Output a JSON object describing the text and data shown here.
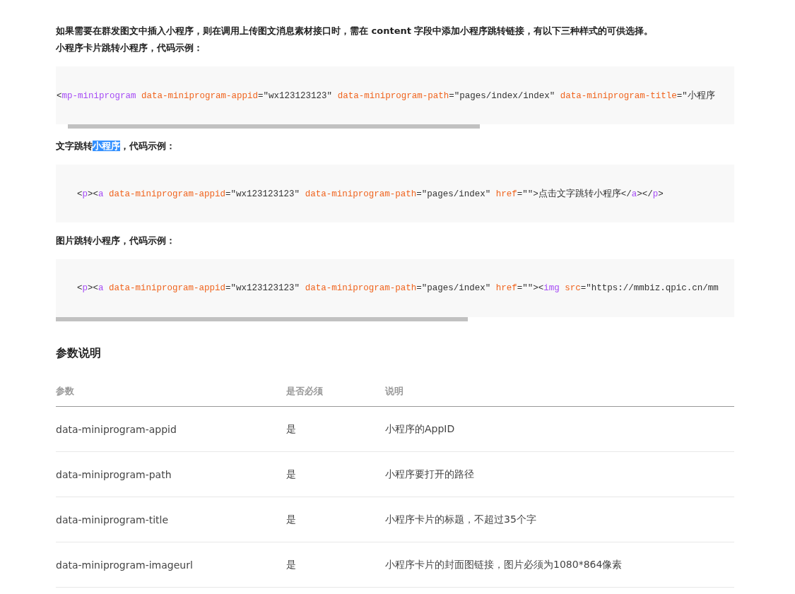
{
  "intro": "如果需要在群发图文中插入小程序，则在调用上传图文消息素材接口时，需在 **content** 字段中添加小程序跳转链接，有以下三种样式的可供选择。",
  "examples": [
    {
      "heading": [
        {
          "text": "小程序卡片跳转小程序，代码示例：",
          "selected": false
        }
      ],
      "indented": false,
      "scrollbar": true,
      "tokens": [
        {
          "kind": "punct",
          "text": "<"
        },
        {
          "kind": "tag",
          "text": "mp-miniprogram"
        },
        {
          "kind": "attr",
          "text": " data-miniprogram-appid"
        },
        {
          "kind": "punct",
          "text": "="
        },
        {
          "kind": "string",
          "text": "\"wx123123123\""
        },
        {
          "kind": "attr",
          "text": " data-miniprogram-path"
        },
        {
          "kind": "punct",
          "text": "="
        },
        {
          "kind": "string",
          "text": "\"pages/index/index\""
        },
        {
          "kind": "attr",
          "text": " data-miniprogram-title"
        },
        {
          "kind": "punct",
          "text": "="
        },
        {
          "kind": "string",
          "text": "\"小程序"
        }
      ]
    },
    {
      "heading": [
        {
          "text": "文字跳转",
          "selected": false
        },
        {
          "text": "小程序",
          "selected": true
        },
        {
          "text": "，代码示例：",
          "selected": false
        }
      ],
      "indented": true,
      "scrollbar": false,
      "tokens": [
        {
          "kind": "punct",
          "text": "<"
        },
        {
          "kind": "tag",
          "text": "p"
        },
        {
          "kind": "punct",
          "text": "><"
        },
        {
          "kind": "tag",
          "text": "a"
        },
        {
          "kind": "attr",
          "text": " data-miniprogram-appid"
        },
        {
          "kind": "punct",
          "text": "="
        },
        {
          "kind": "string",
          "text": "\"wx123123123\""
        },
        {
          "kind": "attr",
          "text": " data-miniprogram-path"
        },
        {
          "kind": "punct",
          "text": "="
        },
        {
          "kind": "string",
          "text": "\"pages/index\""
        },
        {
          "kind": "attr",
          "text": " href"
        },
        {
          "kind": "punct",
          "text": "="
        },
        {
          "kind": "string",
          "text": "\"\""
        },
        {
          "kind": "punct",
          "text": ">点击文字跳转小程序</"
        },
        {
          "kind": "tag",
          "text": "a"
        },
        {
          "kind": "punct",
          "text": "></"
        },
        {
          "kind": "tag",
          "text": "p"
        },
        {
          "kind": "punct",
          "text": ">"
        }
      ]
    },
    {
      "heading": [
        {
          "text": "图片跳转小程序，代码示例：",
          "selected": false
        }
      ],
      "indented": true,
      "scrollbar": true,
      "tokens": [
        {
          "kind": "punct",
          "text": "<"
        },
        {
          "kind": "tag",
          "text": "p"
        },
        {
          "kind": "punct",
          "text": "><"
        },
        {
          "kind": "tag",
          "text": "a"
        },
        {
          "kind": "attr",
          "text": " data-miniprogram-appid"
        },
        {
          "kind": "punct",
          "text": "="
        },
        {
          "kind": "string",
          "text": "\"wx123123123\""
        },
        {
          "kind": "attr",
          "text": " data-miniprogram-path"
        },
        {
          "kind": "punct",
          "text": "="
        },
        {
          "kind": "string",
          "text": "\"pages/index\""
        },
        {
          "kind": "attr",
          "text": " href"
        },
        {
          "kind": "punct",
          "text": "="
        },
        {
          "kind": "string",
          "text": "\"\""
        },
        {
          "kind": "punct",
          "text": "><"
        },
        {
          "kind": "tag",
          "text": "img"
        },
        {
          "kind": "attr",
          "text": " src"
        },
        {
          "kind": "punct",
          "text": "="
        },
        {
          "kind": "string",
          "text": "\"https://mmbiz.qpic.cn/mm"
        }
      ]
    }
  ],
  "params": {
    "title": "参数说明",
    "columns": [
      "参数",
      "是否必须",
      "说明"
    ],
    "rows": [
      [
        "data-miniprogram-appid",
        "是",
        "小程序的AppID"
      ],
      [
        "data-miniprogram-path",
        "是",
        "小程序要打开的路径"
      ],
      [
        "data-miniprogram-title",
        "是",
        "小程序卡片的标题，不超过35个字"
      ],
      [
        "data-miniprogram-imageurl",
        "是",
        "小程序卡片的封面图链接，图片必须为1080*864像素"
      ]
    ]
  }
}
